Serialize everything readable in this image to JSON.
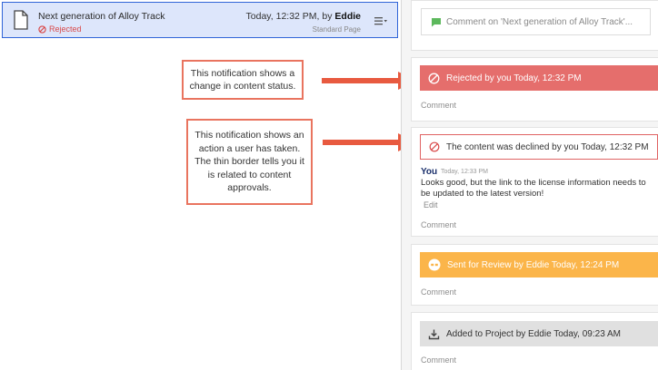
{
  "content_item": {
    "title": "Next generation of Alloy Track",
    "status": "Rejected",
    "meta_prefix": "Today, 12:32 PM, by",
    "author": "Eddie",
    "page_type": "Standard Page",
    "icon": "document-icon"
  },
  "callouts": [
    {
      "text": "This notification shows a change in content status."
    },
    {
      "text": "This notification shows an action a user has taken. The thin border tells you it is related to content approvals."
    }
  ],
  "activity": {
    "comment_placeholder": "Comment on 'Next generation of Alloy Track'...",
    "rejected": {
      "banner": "Rejected by you Today, 12:32 PM",
      "comment_label": "Comment"
    },
    "declined": {
      "banner": "The content was declined by you Today, 12:32 PM",
      "author": "You",
      "time": "Today, 12:33 PM",
      "message": "Looks good, but the link to the license information needs to be updated to the latest version!",
      "edit_label": "Edit",
      "comment_label": "Comment"
    },
    "review": {
      "banner": "Sent for Review by Eddie Today, 12:24 PM",
      "comment_label": "Comment"
    },
    "project": {
      "banner": "Added to Project by Eddie Today, 09:23 AM",
      "comment_label": "Comment"
    }
  },
  "colors": {
    "selection_bg": "#dde6fb",
    "selection_border": "#2f64d8",
    "rejected": "#e56e6c",
    "review": "#fbb54a",
    "callout_border": "#e9745f",
    "arrow": "#e85a40"
  }
}
